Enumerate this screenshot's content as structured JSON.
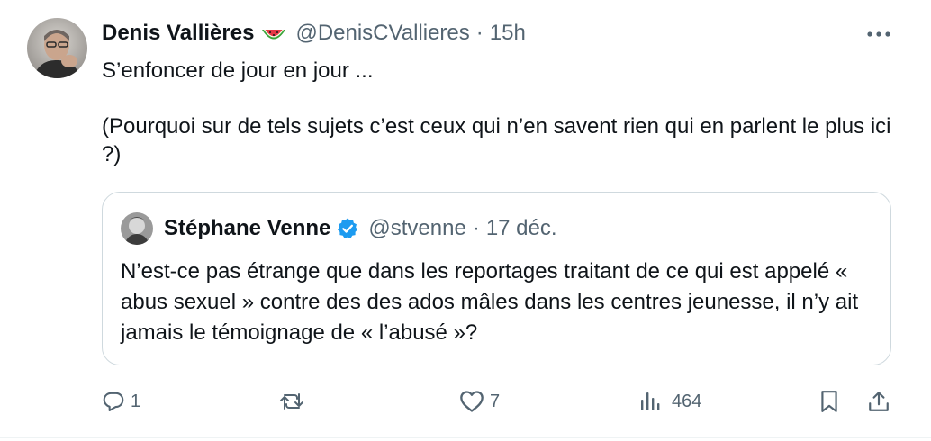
{
  "tweet": {
    "author_name": "Denis Vallières",
    "author_handle": "@DenisCVallieres",
    "separator": "·",
    "time": "15h",
    "name_emoji": "watermelon-emoji",
    "text_line1": "S’enfoncer de jour en jour ...",
    "text_line2": "(Pourquoi sur de tels sujets c’est ceux qui n’en savent rien qui en parlent le plus ici ?)",
    "more_icon": "more-icon"
  },
  "quoted_tweet": {
    "author_name": "Stéphane Venne",
    "author_handle": "@stvenne",
    "separator": "·",
    "time": "17 déc.",
    "verified_icon": "verified-badge-icon",
    "text": "N’est-ce pas étrange que dans les reportages traitant de ce qui est appelé « abus sexuel » contre des des ados mâles dans les centres jeunesse, il n’y ait jamais le témoignage de « l’abusé »?"
  },
  "actions": {
    "reply_count": "1",
    "retweet_count": "",
    "like_count": "7",
    "views_count": "464",
    "icons": [
      "reply-icon",
      "retweet-icon",
      "like-icon",
      "views-icon",
      "bookmark-icon",
      "share-icon"
    ]
  },
  "colors": {
    "text_primary": "#0f1419",
    "text_secondary": "#536471",
    "border": "#cfd9de",
    "verified": "#1d9bf0"
  }
}
